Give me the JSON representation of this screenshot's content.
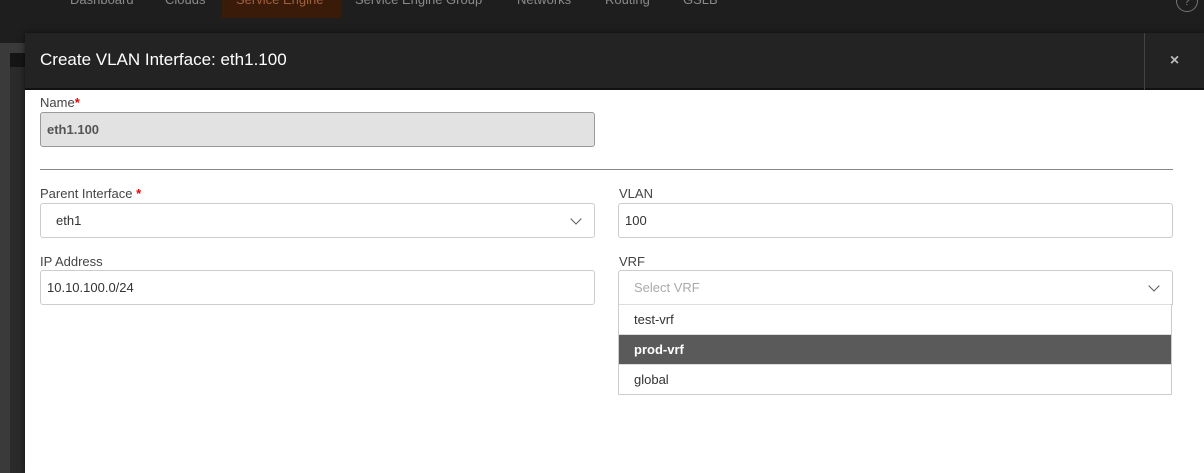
{
  "nav": {
    "tabs": [
      "Dashboard",
      "Clouds",
      "Service Engine",
      "Service Engine Group",
      "Networks",
      "Routing",
      "GSLB"
    ],
    "active": "Service Engine",
    "help": "?"
  },
  "modal": {
    "title": "Create VLAN Interface: eth1.100",
    "close": "×"
  },
  "form": {
    "name": {
      "label": "Name",
      "required": "*",
      "value": "eth1.100"
    },
    "parent": {
      "label": "Parent Interface",
      "required": "*",
      "value": "eth1"
    },
    "vlan": {
      "label": "VLAN",
      "value": "100"
    },
    "ip": {
      "label": "IP Address",
      "value": "10.10.100.0/24"
    },
    "vrf": {
      "label": "VRF",
      "placeholder": "Select VRF",
      "options": [
        "test-vrf",
        "prod-vrf",
        "global"
      ],
      "highlighted": "prod-vrf"
    }
  }
}
